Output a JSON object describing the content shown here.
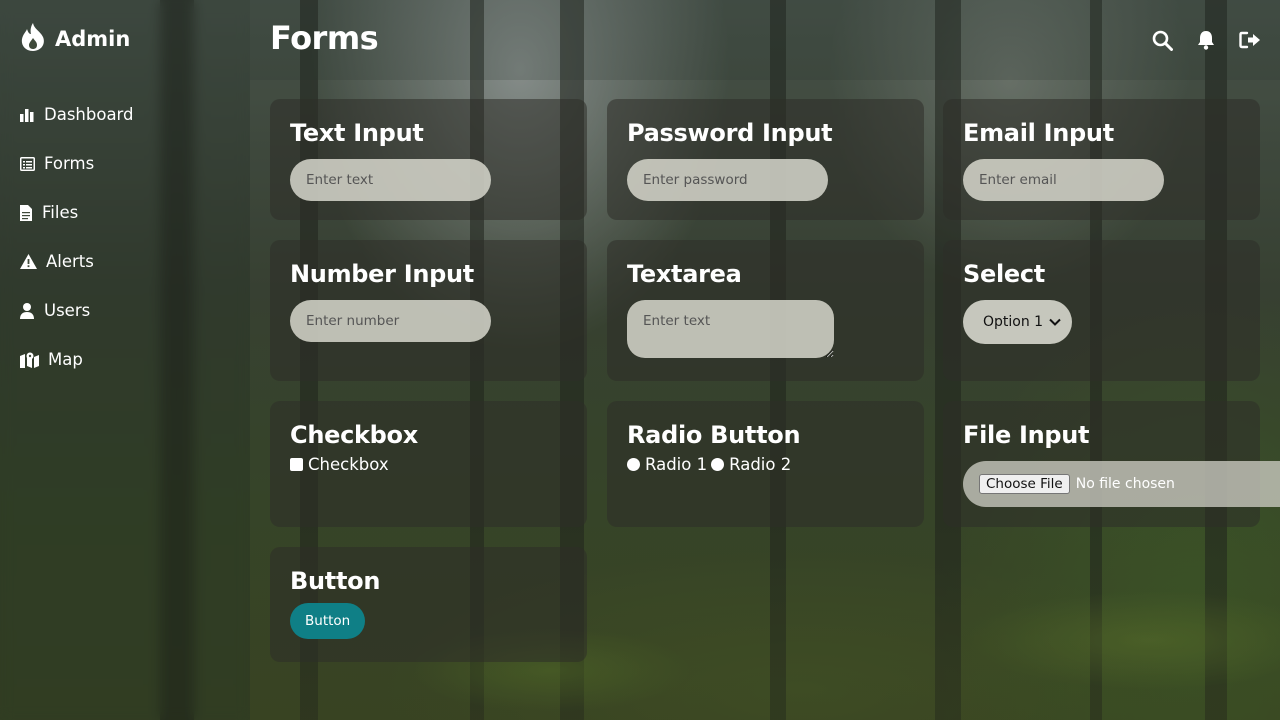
{
  "brand": {
    "label": "Admin",
    "icon": "fire-icon"
  },
  "sidebar": {
    "items": [
      {
        "label": "Dashboard",
        "icon": "bar-chart-icon"
      },
      {
        "label": "Forms",
        "icon": "list-alt-icon"
      },
      {
        "label": "Files",
        "icon": "file-icon"
      },
      {
        "label": "Alerts",
        "icon": "warning-icon"
      },
      {
        "label": "Users",
        "icon": "user-icon"
      },
      {
        "label": "Map",
        "icon": "map-icon"
      }
    ]
  },
  "header": {
    "title": "Forms",
    "actions": [
      "search-icon",
      "bell-icon",
      "logout-icon"
    ]
  },
  "cards": {
    "text_input": {
      "title": "Text Input",
      "placeholder": "Enter text"
    },
    "password_input": {
      "title": "Password Input",
      "placeholder": "Enter password"
    },
    "email_input": {
      "title": "Email Input",
      "placeholder": "Enter email"
    },
    "number_input": {
      "title": "Number Input",
      "placeholder": "Enter number"
    },
    "textarea": {
      "title": "Textarea",
      "placeholder": "Enter text"
    },
    "select": {
      "title": "Select",
      "selected": "Option 1"
    },
    "checkbox": {
      "title": "Checkbox",
      "label": "Checkbox"
    },
    "radio": {
      "title": "Radio Button",
      "options": [
        "Radio 1",
        "Radio 2"
      ]
    },
    "file_input": {
      "title": "File Input",
      "button_label": "Choose File",
      "status": "No file chosen"
    },
    "button": {
      "title": "Button",
      "label": "Button"
    }
  },
  "colors": {
    "accent": "#0f7f86",
    "card_bg": "#2d2d28",
    "input_bg": "#d7d7cd"
  }
}
